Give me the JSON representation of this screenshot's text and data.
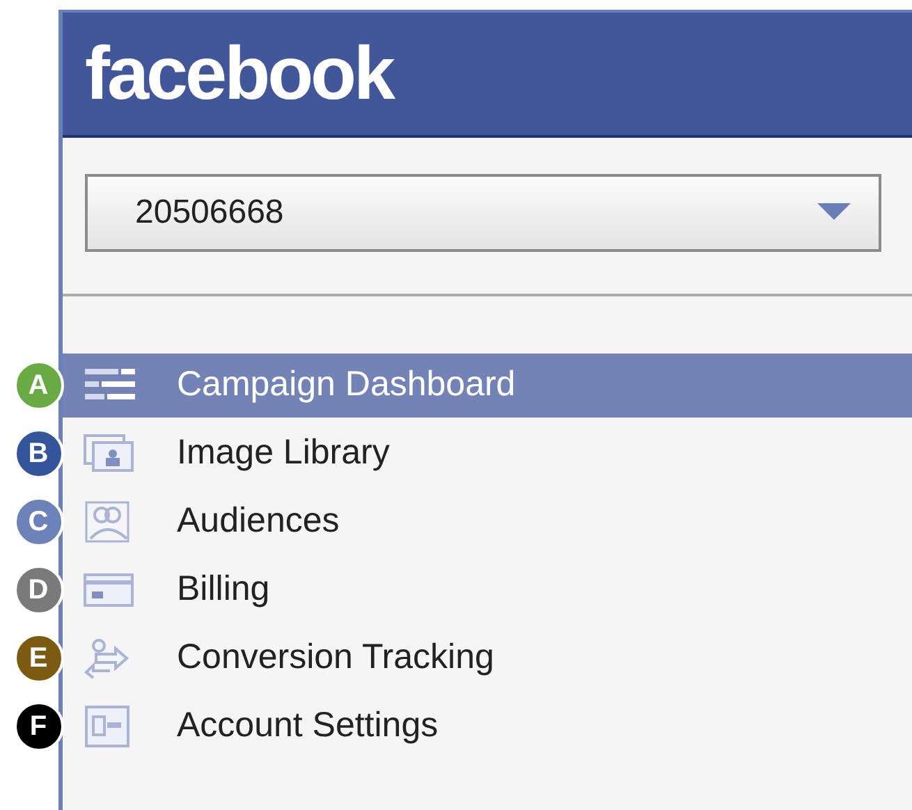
{
  "header": {
    "logo": "facebook"
  },
  "account_select": {
    "value": "20506668"
  },
  "menu": [
    {
      "label": "Campaign Dashboard",
      "badge": "A",
      "color": "#6aaa45",
      "kind": "dashboard",
      "selected": true
    },
    {
      "label": "Image Library",
      "badge": "B",
      "color": "#34559a",
      "kind": "images",
      "selected": false
    },
    {
      "label": "Audiences",
      "badge": "C",
      "color": "#6c82b8",
      "kind": "people",
      "selected": false
    },
    {
      "label": "Billing",
      "badge": "D",
      "color": "#7a7a7a",
      "kind": "card",
      "selected": false
    },
    {
      "label": "Conversion Tracking",
      "badge": "E",
      "color": "#7c5a12",
      "kind": "arrows",
      "selected": false
    },
    {
      "label": "Account Settings",
      "badge": "F",
      "color": "#000000",
      "kind": "settings",
      "selected": false
    }
  ]
}
